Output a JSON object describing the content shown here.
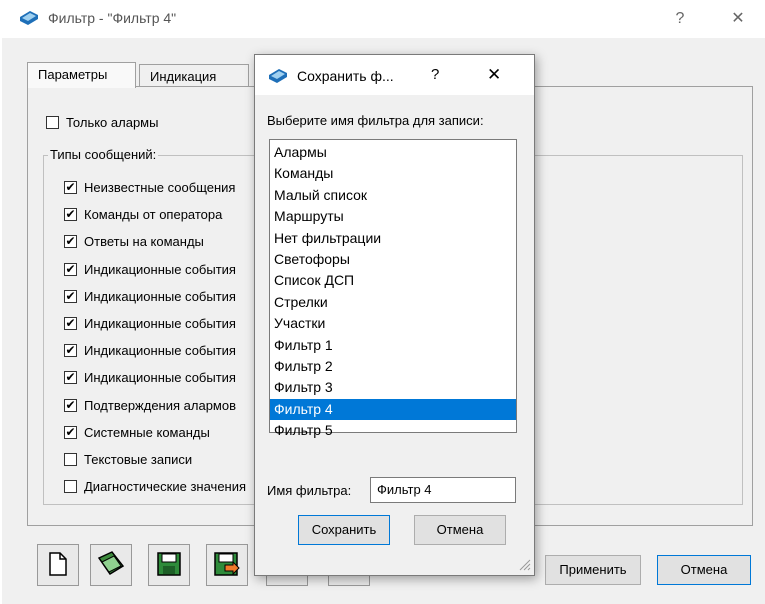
{
  "main": {
    "title": "Фильтр - \"Фильтр 4\"",
    "help_glyph": "?",
    "close_glyph": "✕",
    "tabs": [
      "Параметры",
      "Индикация"
    ],
    "only_alarms": {
      "label": "Только алармы",
      "checked": false
    },
    "group_title": "Типы сообщений:",
    "message_types": [
      {
        "label": "Неизвестные сообщения",
        "checked": true
      },
      {
        "label": "Команды от оператора",
        "checked": true
      },
      {
        "label": "Ответы на команды",
        "checked": true
      },
      {
        "label": "Индикационные события",
        "checked": true
      },
      {
        "label": "Индикационные события",
        "checked": true
      },
      {
        "label": "Индикационные события",
        "checked": true
      },
      {
        "label": "Индикационные события",
        "checked": true
      },
      {
        "label": "Индикационные события",
        "checked": true
      },
      {
        "label": "Подтверждения алармов",
        "checked": true
      },
      {
        "label": "Системные команды",
        "checked": true
      },
      {
        "label": "Текстовые записи",
        "checked": false
      },
      {
        "label": "Диагностические значения",
        "checked": false
      }
    ],
    "apply_label": "Применить",
    "cancel_label": "Отмена",
    "toolbar_icons": [
      "new-file-icon",
      "open-folder-icon",
      "save-disk-icon",
      "save-as-disk-icon",
      "eraser-icon",
      "delete-x-icon"
    ]
  },
  "dialog": {
    "title": "Сохранить ф...",
    "help_glyph": "?",
    "close_glyph": "✕",
    "prompt": "Выберите имя фильтра для записи:",
    "filters": [
      "Алармы",
      "Команды",
      "Малый список",
      "Маршруты",
      "Нет фильтрации",
      "Светофоры",
      "Список ДСП",
      "Стрелки",
      "Участки",
      "Фильтр 1",
      "Фильтр 2",
      "Фильтр 3",
      "Фильтр 4",
      "Фильтр 5"
    ],
    "selected": "Фильтр 4",
    "name_label": "Имя фильтра:",
    "name_value": "Фильтр 4",
    "save_label": "Сохранить",
    "cancel_label": "Отмена"
  },
  "colors": {
    "selection": "#0078d7",
    "icon_green": "#2e7d32"
  }
}
